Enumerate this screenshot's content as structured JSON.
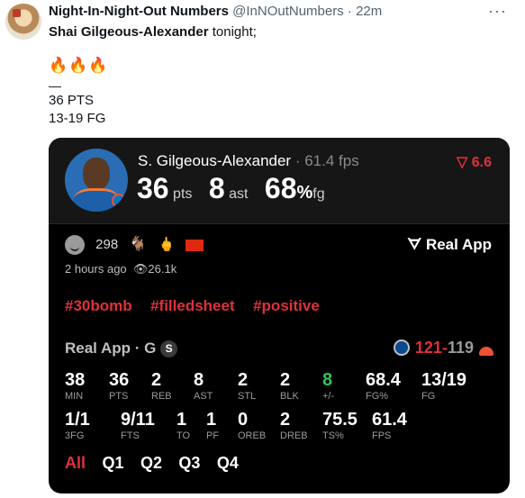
{
  "tweet": {
    "author_name": "Night-In-Night-Out Numbers",
    "handle": "@InNOutNumbers",
    "separator": "·",
    "time": "22m",
    "more": "···",
    "text_name": "Shai Gilgeous-Alexander",
    "text_rest": " tonight;",
    "fires": "🔥🔥🔥",
    "dash": "—",
    "line_pts": "36 PTS",
    "line_fg": "13-19 FG"
  },
  "card": {
    "player_name": "S. Gilgeous-Alexander",
    "fps_label": " · 61.4 fps",
    "trend": "6.6",
    "big": {
      "pts_value": "36",
      "pts_unit": "pts",
      "ast_value": "8",
      "ast_unit": "ast",
      "fg_value": "68",
      "fg_pct": "%",
      "fg_unit": "fg"
    },
    "reactions": {
      "smiley_count": "298",
      "goat": "🐐",
      "finger": "🖕"
    },
    "real_app_label": "Real App",
    "time_ago": "2 hours ago",
    "views": "26.1k",
    "hashtags": [
      "#30bomb",
      "#filledsheet",
      "#positive"
    ],
    "game": {
      "source": "Real App · G",
      "badge": "S",
      "score_win": "121",
      "score_sep": "-",
      "score_loss": "119"
    },
    "stats_row1": [
      {
        "value": "38",
        "label": "MIN"
      },
      {
        "value": "36",
        "label": "PTS"
      },
      {
        "value": "2",
        "label": "REB"
      },
      {
        "value": "8",
        "label": "AST"
      },
      {
        "value": "2",
        "label": "STL"
      },
      {
        "value": "2",
        "label": "BLK"
      },
      {
        "value": "8",
        "label": "+/-"
      },
      {
        "value": "68.4",
        "label": "FG%"
      },
      {
        "value": "13/19",
        "label": "FG"
      }
    ],
    "stats_row2": [
      {
        "value": "1/1",
        "label": "3FG"
      },
      {
        "value": "9/11",
        "label": "FTS"
      },
      {
        "value": "1",
        "label": "TO"
      },
      {
        "value": "1",
        "label": "PF"
      },
      {
        "value": "0",
        "label": "OREB"
      },
      {
        "value": "2",
        "label": "DREB"
      },
      {
        "value": "75.5",
        "label": "TS%"
      },
      {
        "value": "61.4",
        "label": "FPS"
      }
    ],
    "quarter_tabs": [
      "All",
      "Q1",
      "Q2",
      "Q3",
      "Q4"
    ],
    "active_tab": "All"
  },
  "colors": {
    "accent_red": "#e0313a",
    "positive_green": "#2ec45a",
    "card_bg": "#000000"
  }
}
